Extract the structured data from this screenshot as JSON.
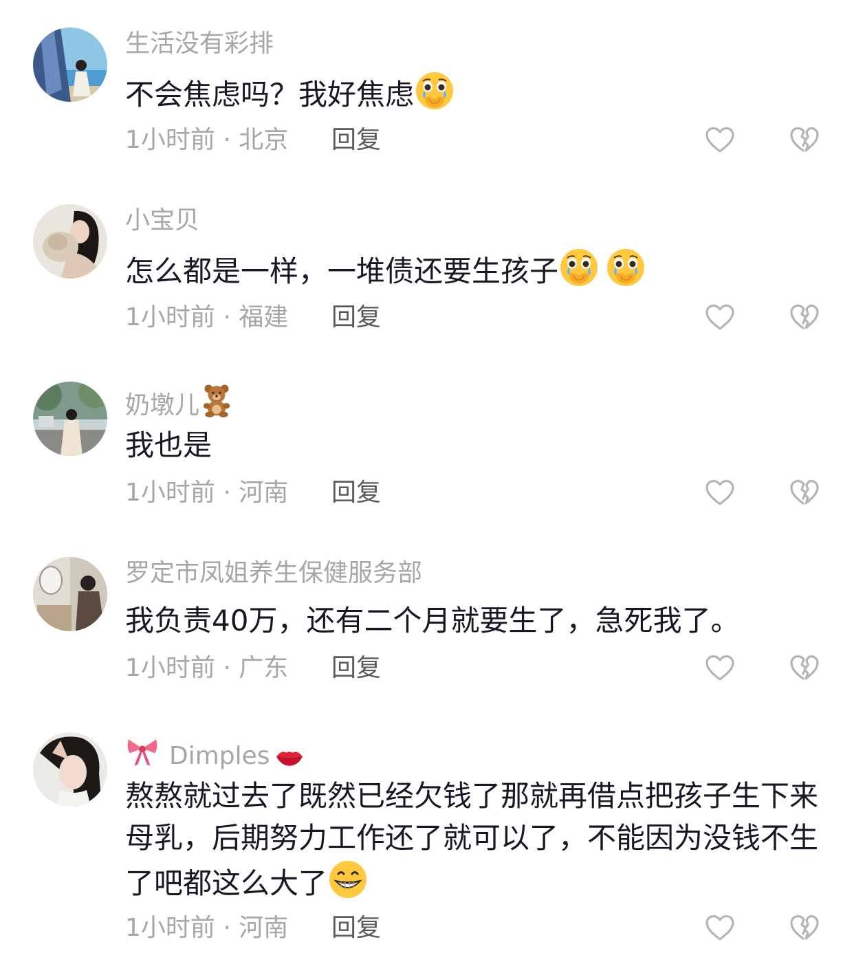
{
  "comments": [
    {
      "username": "生活没有彩排",
      "text": "不会焦虑吗？我好焦虑",
      "text_emojis": [
        "crying-covering-mouth"
      ],
      "time": "1小时前",
      "location": "北京",
      "meta": "1小时前 · 北京",
      "reply_label": "回复"
    },
    {
      "username": "小宝贝",
      "text": "怎么都是一样，一堆债还要生孩子",
      "text_emojis": [
        "crying-covering-mouth",
        "crying-covering-mouth"
      ],
      "time": "1小时前",
      "location": "福建",
      "meta": "1小时前 · 福建",
      "reply_label": "回复"
    },
    {
      "username": "奶墩儿",
      "username_emoji": "teddy-bear",
      "text": "我也是",
      "time": "1小时前",
      "location": "河南",
      "meta": "1小时前 · 河南",
      "reply_label": "回复"
    },
    {
      "username": "罗定市凤姐养生保健服务部",
      "text": "我负责40万，还有二个月就要生了，急死我了。",
      "time": "1小时前",
      "location": "广东",
      "meta": "1小时前 · 广东",
      "reply_label": "回复"
    },
    {
      "username": "Dimples",
      "username_prefix_emoji": "pink-bow",
      "username_emoji": "kiss-lips",
      "text": "熬熬就过去了既然已经欠钱了那就再借点把孩子生下来母乳，后期努力工作还了就可以了，不能因为没钱不生了吧都这么大了",
      "text_emojis": [
        "grinning-face"
      ],
      "time": "1小时前",
      "location": "河南",
      "meta": "1小时前 · 河南",
      "reply_label": "回复"
    }
  ],
  "icons": {
    "like": "heart-outline-icon",
    "dislike": "broken-heart-outline-icon"
  },
  "colors": {
    "username": "#a6a6ab",
    "content": "#161823",
    "meta": "#a6a6ab",
    "reply": "#5a5a5e",
    "icon_stroke": "#b4b4b8"
  }
}
